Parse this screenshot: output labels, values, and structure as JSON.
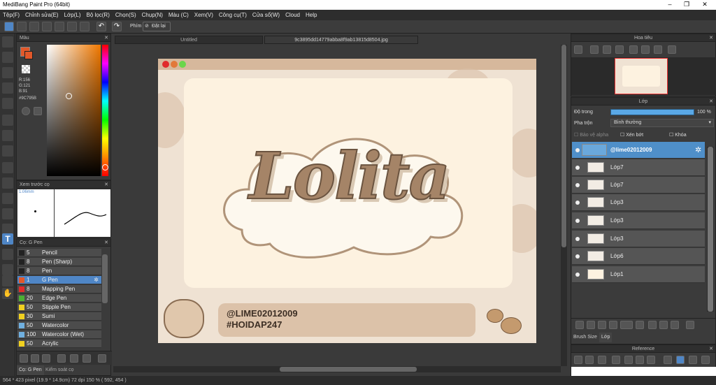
{
  "window": {
    "title": "MediBang Paint Pro (64bit)"
  },
  "menu": [
    "Tệp(F)",
    "Chỉnh sửa(E)",
    "Lớp(L)",
    "Bộ lọc(R)",
    "Chọn(S)",
    "Chụp(N)",
    "Màu (C)",
    "Xem(V)",
    "Công cụ(T)",
    "Cửa sổ(W)",
    "Cloud",
    "Help"
  ],
  "toolbar": {
    "phim_label": "Phím",
    "reset_label": "Đặt lại"
  },
  "panels": {
    "color": {
      "title": "Màu",
      "r": "R:156",
      "g": "G:121",
      "b": "B:91",
      "hex": "#9C795B",
      "fg": "#e2582a",
      "accent": "#9C795B"
    },
    "brush_preview": {
      "title": "Xem trước cọ",
      "size": "1.06mm"
    },
    "brush": {
      "title": "Cọ: G Pen",
      "items": [
        {
          "size": "5",
          "name": "Pencil",
          "color": "#222222"
        },
        {
          "size": "8",
          "name": "Pen (Sharp)",
          "color": "#222222"
        },
        {
          "size": "8",
          "name": "Pen",
          "color": "#222222"
        },
        {
          "size": "1",
          "name": "G Pen",
          "color": "#e2582a"
        },
        {
          "size": "8",
          "name": "Mapping Pen",
          "color": "#e22a2a"
        },
        {
          "size": "20",
          "name": "Edge Pen",
          "color": "#4caf32"
        },
        {
          "size": "50",
          "name": "Stipple Pen",
          "color": "#f0d020"
        },
        {
          "size": "30",
          "name": "Sumi",
          "color": "#f0d020"
        },
        {
          "size": "50",
          "name": "Watercolor",
          "color": "#70b0e0"
        },
        {
          "size": "100",
          "name": "Watercolor (Wet)",
          "color": "#70b0e0"
        },
        {
          "size": "50",
          "name": "Acrylic",
          "color": "#f0d020"
        }
      ]
    },
    "bottom_tabs": [
      "Cọ: G Pen",
      "Kiểm soát cọ"
    ]
  },
  "tabs": [
    "Untitled",
    "9c3895dd14779abba8f9ab13815d8504.jpg"
  ],
  "artwork": {
    "title": "Lolita",
    "line1": "@LIME02012009",
    "line2": "#HOIDAP247"
  },
  "navigator": {
    "title": "Hoa tiêu"
  },
  "layers": {
    "title": "Lớp",
    "opacity_label": "Độ trong",
    "opacity_value": "100 %",
    "blend_label": "Pha trộn",
    "blend_value": "Bình thường",
    "protect_alpha": "Bảo vệ alpha",
    "clip": "Xén bớt",
    "lock": "Khóa",
    "items": [
      "@lime02012009",
      "Lớp7",
      "Lớp7",
      "Lớp3",
      "Lớp3",
      "Lớp3",
      "Lớp6",
      "Lớp1"
    ],
    "bottom_tabs": [
      "Brush Size",
      "Lớp"
    ]
  },
  "reference": {
    "title": "Reference"
  },
  "status": {
    "text": "564 * 423 pixel   (19.9 * 14.9cm)   72 dpi   150 %   ( 592, 454 )"
  }
}
